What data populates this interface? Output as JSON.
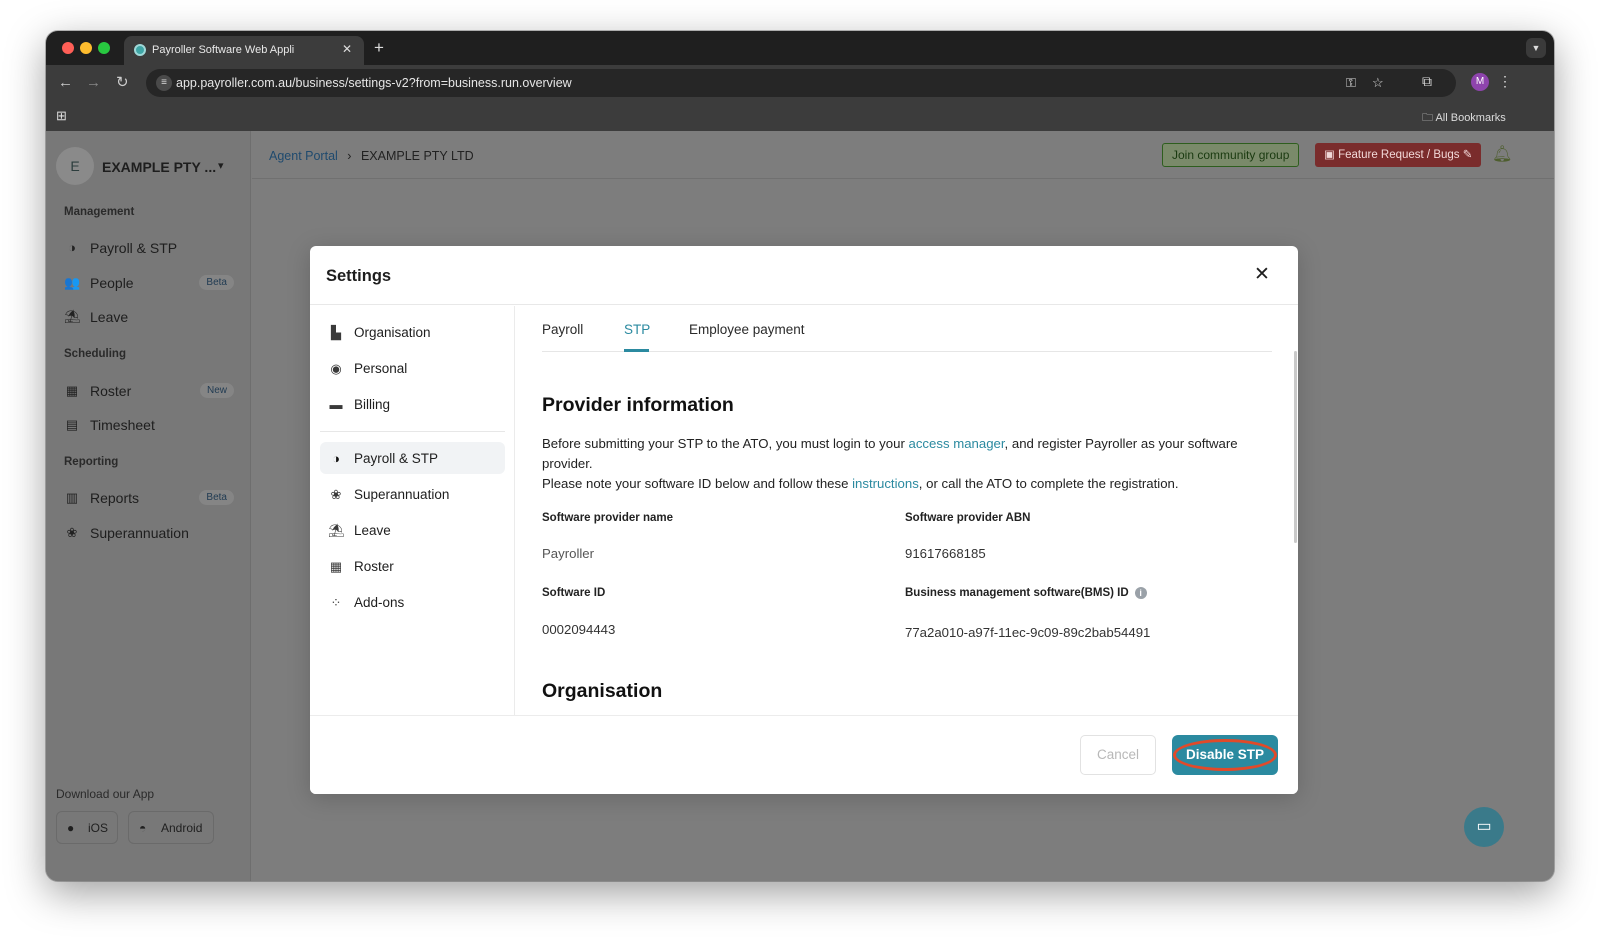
{
  "browser": {
    "tab_title": "Payroller Software Web Appli",
    "url": "app.payroller.com.au/business/settings-v2?from=business.run.overview",
    "profile_initial": "M",
    "bookmarks_label": "All Bookmarks"
  },
  "sidebar": {
    "company_initial": "E",
    "company_name": "EXAMPLE PTY ...",
    "sections": {
      "management": "Management",
      "scheduling": "Scheduling",
      "reporting": "Reporting"
    },
    "items": [
      {
        "label": "Payroll & STP",
        "icon": "payroll-icon"
      },
      {
        "label": "People",
        "badge": "Beta",
        "icon": "people-icon"
      },
      {
        "label": "Leave",
        "icon": "leave-icon"
      },
      {
        "label": "Roster",
        "badge": "New",
        "icon": "roster-icon"
      },
      {
        "label": "Timesheet",
        "icon": "timesheet-icon"
      },
      {
        "label": "Reports",
        "badge": "Beta",
        "icon": "reports-icon"
      },
      {
        "label": "Superannuation",
        "icon": "superannuation-icon"
      }
    ],
    "download_label": "Download our App",
    "ios_label": "iOS",
    "android_label": "Android"
  },
  "header": {
    "breadcrumb_root": "Agent Portal",
    "breadcrumb_current": "EXAMPLE PTY LTD",
    "join_label": "Join community group",
    "feature_label": "Feature Request / Bugs"
  },
  "modal": {
    "title": "Settings",
    "nav": [
      {
        "label": "Organisation"
      },
      {
        "label": "Personal"
      },
      {
        "label": "Billing"
      },
      {
        "label": "Payroll & STP",
        "active": true
      },
      {
        "label": "Superannuation"
      },
      {
        "label": "Leave"
      },
      {
        "label": "Roster"
      },
      {
        "label": "Add-ons"
      }
    ],
    "tabs": [
      "Payroll",
      "STP",
      "Employee payment"
    ],
    "active_tab": "STP",
    "provider_heading": "Provider information",
    "para1_before": "Before submitting your STP to the ATO, you must login to your ",
    "para1_link": "access manager",
    "para1_after": ", and register Payroller as your software provider.",
    "para2_before": "Please note your software ID below and follow these ",
    "para2_link": "instructions",
    "para2_after": ", or call the ATO to complete the registration.",
    "fields": {
      "provider_name_label": "Software provider name",
      "provider_name_value": "Payroller",
      "provider_abn_label": "Software provider ABN",
      "provider_abn_value": "91617668185",
      "software_id_label": "Software ID",
      "software_id_value": "0002094443",
      "bms_id_label": "Business management software(BMS) ID",
      "bms_id_value": "77a2a010-a97f-11ec-9c09-89c2bab54491"
    },
    "organisation_heading": "Organisation",
    "cancel_label": "Cancel",
    "primary_label": "Disable STP"
  },
  "colors": {
    "accent": "#2b8aa0",
    "highlight_ring": "#e04a2a"
  }
}
